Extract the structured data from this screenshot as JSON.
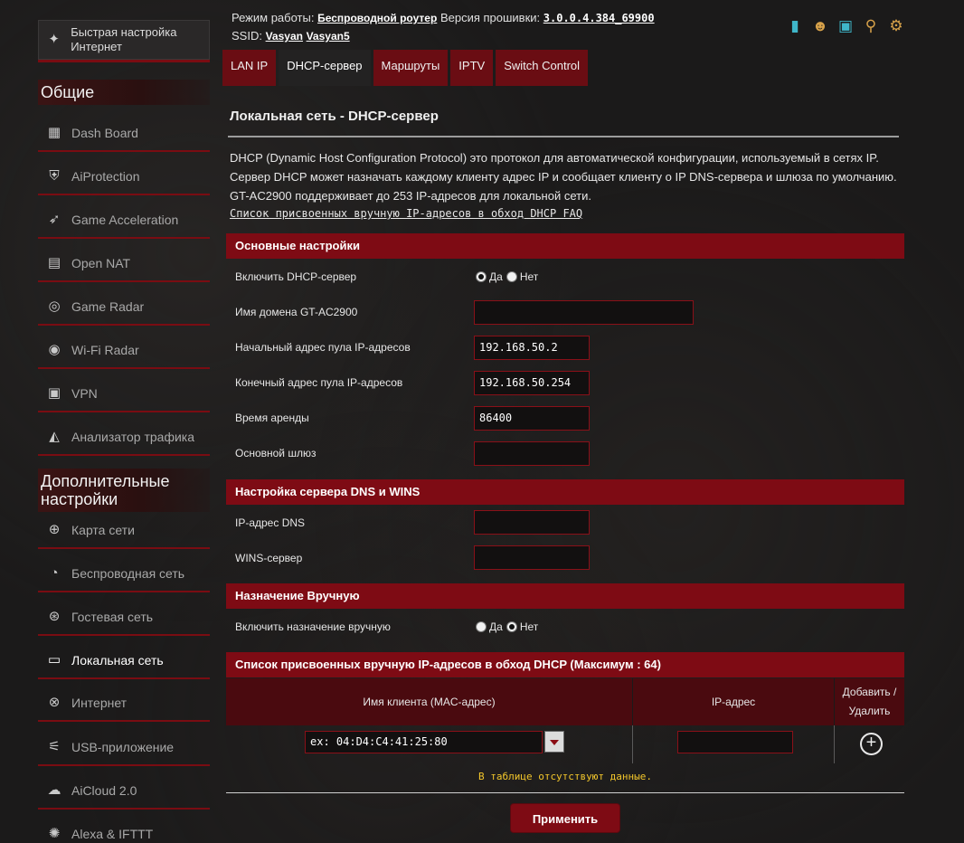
{
  "sidebar": {
    "quick_setup": "Быстрая настройка Интернет",
    "general_title": "Общие",
    "general_items": [
      {
        "label": "Dash Board",
        "icon": "dashboard-icon"
      },
      {
        "label": "AiProtection",
        "icon": "shield-lock-icon"
      },
      {
        "label": "Game Acceleration",
        "icon": "rocket-icon"
      },
      {
        "label": "Open NAT",
        "icon": "open-nat-icon"
      },
      {
        "label": "Game Radar",
        "icon": "radar-icon"
      },
      {
        "label": "Wi-Fi Radar",
        "icon": "wifi-radar-icon"
      },
      {
        "label": "VPN",
        "icon": "vpn-icon"
      },
      {
        "label": "Анализатор трафика",
        "icon": "traffic-analyzer-icon"
      }
    ],
    "advanced_title": "Дополнительные настройки",
    "advanced_items": [
      {
        "label": "Карта сети",
        "icon": "globe-icon"
      },
      {
        "label": "Беспроводная сеть",
        "icon": "wireless-icon"
      },
      {
        "label": "Гостевая сеть",
        "icon": "guest-network-icon"
      },
      {
        "label": "Локальная сеть",
        "icon": "lan-icon"
      },
      {
        "label": "Интернет",
        "icon": "internet-globe-icon"
      },
      {
        "label": "USB-приложение",
        "icon": "usb-icon"
      },
      {
        "label": "AiCloud 2.0",
        "icon": "cloud-icon"
      },
      {
        "label": "Alexa & IFTTT",
        "icon": "alexa-icon"
      }
    ]
  },
  "header": {
    "mode_label": "Режим работы:",
    "mode_value": "Беспроводной роутер",
    "firmware_label": "Версия прошивки:",
    "firmware_value": "3.0.0.4.384_69900",
    "ssid_label": "SSID:",
    "ssid_1": "Vasyan",
    "ssid_2": "Vasyan5"
  },
  "tabs": [
    {
      "label": "LAN IP",
      "active": false
    },
    {
      "label": "DHCP-сервер",
      "active": true
    },
    {
      "label": "Маршруты",
      "active": false
    },
    {
      "label": "IPTV",
      "active": false
    },
    {
      "label": "Switch Control",
      "active": false
    }
  ],
  "page": {
    "title": "Локальная сеть - DHCP-сервер",
    "desc_1": "DHCP (Dynamic Host Configuration Protocol) это протокол для автоматической конфигурации, используемый в сетях IP.",
    "desc_2": "Сервер DHCP может назначать каждому клиенту адрес IP и сообщает клиенту о IP DNS-сервера и шлюза по умолчанию.",
    "desc_3": "GT-AC2900 поддерживает до 253 IP-адресов для локальной сети.",
    "faq_link": "Список присвоенных вручную IP-адресов в обход DHCP FAQ"
  },
  "basic": {
    "title": "Основные настройки",
    "enable_dhcp_label": "Включить DHCP-сервер",
    "yes": "Да",
    "no": "Нет",
    "domain_label": "Имя домена GT-AC2900",
    "domain_value": "",
    "start_label": "Начальный адрес пула IP-адресов",
    "start_value": "192.168.50.2",
    "end_label": "Конечный адрес пула IP-адресов",
    "end_value": "192.168.50.254",
    "lease_label": "Время аренды",
    "lease_value": "86400",
    "gateway_label": "Основной шлюз",
    "gateway_value": ""
  },
  "dns": {
    "title": "Настройка сервера DNS и WINS",
    "dns_label": "IP-адрес DNS",
    "dns_value": "",
    "wins_label": "WINS-сервер",
    "wins_value": ""
  },
  "manual": {
    "title": "Назначение Вручную",
    "enable_label": "Включить назначение вручную",
    "yes": "Да",
    "no": "Нет"
  },
  "table": {
    "title": "Список присвоенных вручную IP-адресов в обход DHCP (Максимум : 64)",
    "col_client": "Имя клиента (MAC-адрес)",
    "col_ip": "IP-адрес",
    "col_action_1": "Добавить /",
    "col_action_2": "Удалить",
    "mac_placeholder": "ex: 04:D4:C4:41:25:80",
    "ip_value": "",
    "empty": "В таблице отсутствуют данные."
  },
  "apply_label": "Применить",
  "accent_color": "#7e0b14"
}
